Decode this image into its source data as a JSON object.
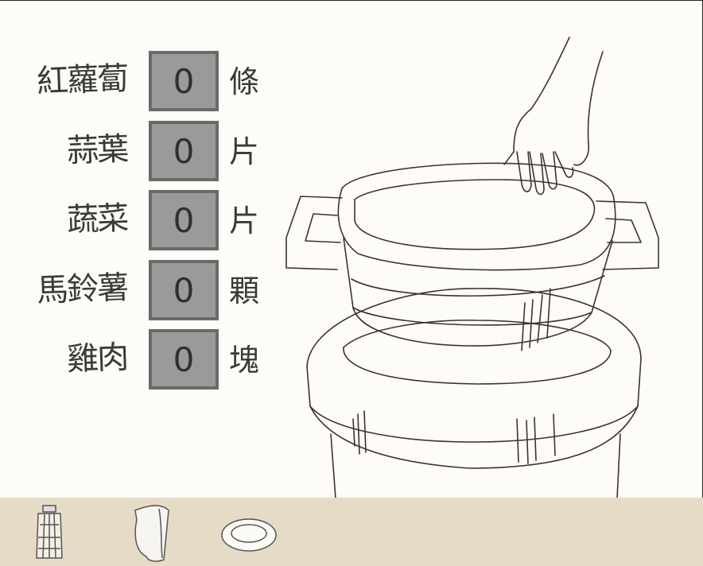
{
  "ingredients": [
    {
      "name": "紅蘿蔔",
      "quantity": "0",
      "unit": "條"
    },
    {
      "name": "蒜葉",
      "quantity": "0",
      "unit": "片"
    },
    {
      "name": "蔬菜",
      "quantity": "0",
      "unit": "片"
    },
    {
      "name": "馬鈴薯",
      "quantity": "0",
      "unit": "顆"
    },
    {
      "name": "雞肉",
      "quantity": "0",
      "unit": "塊"
    }
  ],
  "inventory": {
    "items": [
      {
        "icon": "lantern-icon"
      },
      {
        "icon": "cloth-icon"
      },
      {
        "icon": "plate-icon"
      }
    ]
  },
  "colors": {
    "background": "#fdfcf6",
    "quantity_box": "#9a9a9a",
    "quantity_border": "#6a6a6a",
    "tray": "#e6dbc7",
    "sketch_line": "#3d3330"
  }
}
